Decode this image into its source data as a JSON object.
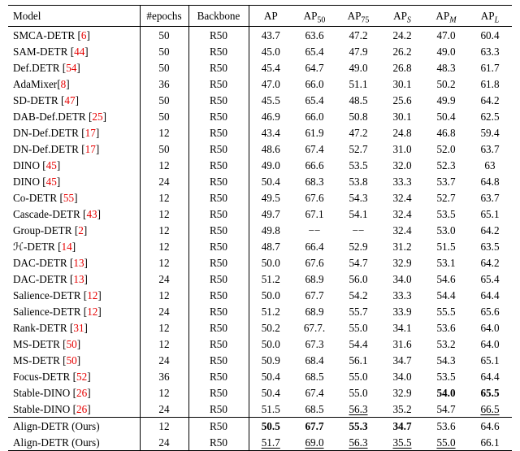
{
  "chart_data": {
    "type": "table",
    "title": "",
    "columns": [
      "Model",
      "#epochs",
      "Backbone",
      "AP",
      "AP50",
      "AP75",
      "AP_S",
      "AP_M",
      "AP_L"
    ],
    "rows": [
      [
        "SMCA-DETR [6]",
        50,
        "R50",
        43.7,
        63.6,
        47.2,
        24.2,
        47.0,
        60.4
      ],
      [
        "SAM-DETR [44]",
        50,
        "R50",
        45.0,
        65.4,
        47.9,
        26.2,
        49.0,
        63.3
      ],
      [
        "Def.DETR [54]",
        50,
        "R50",
        45.4,
        64.7,
        49.0,
        26.8,
        48.3,
        61.7
      ],
      [
        "AdaMixer[8]",
        36,
        "R50",
        47.0,
        66.0,
        51.1,
        30.1,
        50.2,
        61.8
      ],
      [
        "SD-DETR [47]",
        50,
        "R50",
        45.5,
        65.4,
        48.5,
        25.6,
        49.9,
        64.2
      ],
      [
        "DAB-Def.DETR [25]",
        50,
        "R50",
        46.9,
        66.0,
        50.8,
        30.1,
        50.4,
        62.5
      ],
      [
        "DN-Def.DETR [17]",
        12,
        "R50",
        43.4,
        61.9,
        47.2,
        24.8,
        46.8,
        59.4
      ],
      [
        "DN-Def.DETR [17]",
        50,
        "R50",
        48.6,
        67.4,
        52.7,
        31.0,
        52.0,
        63.7
      ],
      [
        "DINO [45]",
        12,
        "R50",
        49.0,
        66.6,
        53.5,
        32.0,
        52.3,
        63
      ],
      [
        "DINO [45]",
        24,
        "R50",
        50.4,
        68.3,
        53.8,
        33.3,
        53.7,
        64.8
      ],
      [
        "Co-DETR [55]",
        12,
        "R50",
        49.5,
        67.6,
        54.3,
        32.4,
        52.7,
        63.7
      ],
      [
        "Cascade-DETR [43]",
        12,
        "R50",
        49.7,
        67.1,
        54.1,
        32.4,
        53.5,
        65.1
      ],
      [
        "Group-DETR [2]",
        12,
        "R50",
        49.8,
        "−−",
        "−−",
        32.4,
        53.0,
        64.2
      ],
      [
        "H-DETR [14]",
        12,
        "R50",
        48.7,
        66.4,
        52.9,
        31.2,
        51.5,
        63.5
      ],
      [
        "DAC-DETR [13]",
        12,
        "R50",
        50.0,
        67.6,
        54.7,
        32.9,
        53.1,
        64.2
      ],
      [
        "DAC-DETR [13]",
        24,
        "R50",
        51.2,
        68.9,
        56.0,
        34.0,
        54.6,
        65.4
      ],
      [
        "Salience-DETR [12]",
        12,
        "R50",
        50.0,
        67.7,
        54.2,
        33.3,
        54.4,
        64.4
      ],
      [
        "Salience-DETR [12]",
        24,
        "R50",
        51.2,
        68.9,
        55.7,
        33.9,
        55.5,
        65.6
      ],
      [
        "Rank-DETR [31]",
        12,
        "R50",
        50.2,
        "67.7.",
        55.0,
        34.1,
        53.6,
        64.0
      ],
      [
        "MS-DETR [50]",
        12,
        "R50",
        50.0,
        67.3,
        54.4,
        31.6,
        53.2,
        64.0
      ],
      [
        "MS-DETR [50]",
        24,
        "R50",
        50.9,
        68.4,
        56.1,
        34.7,
        54.3,
        65.1
      ],
      [
        "Focus-DETR [52]",
        36,
        "R50",
        50.4,
        68.5,
        55.0,
        34.0,
        53.5,
        64.4
      ],
      [
        "Stable-DINO [26]",
        12,
        "R50",
        50.4,
        67.4,
        55.0,
        32.9,
        54.0,
        65.5
      ],
      [
        "Stable-DINO [26]",
        24,
        "R50",
        51.5,
        68.5,
        56.3,
        35.2,
        54.7,
        66.5
      ],
      [
        "Align-DETR (Ours)",
        12,
        "R50",
        50.5,
        67.7,
        55.3,
        34.7,
        53.6,
        64.6
      ],
      [
        "Align-DETR (Ours)",
        24,
        "R50",
        51.7,
        69.0,
        56.3,
        35.5,
        55.0,
        66.1
      ]
    ],
    "styles": {
      "22": {
        "AP_M": "bold",
        "AP_L": "bold"
      },
      "23": {
        "AP75": "uline",
        "AP_L": "uline"
      },
      "24": {
        "AP": "bold",
        "AP50": "bold",
        "AP75": "bold",
        "AP_S": "bold"
      },
      "25": {
        "AP": "uline",
        "AP50": "uline",
        "AP75": "uline",
        "AP_S": "uline",
        "AP_M": "uline"
      }
    },
    "separator_before_row": 24
  },
  "header": {
    "model": "Model",
    "epochs": "#epochs",
    "backbone": "Backbone",
    "ap": "AP",
    "ap50_pre": "AP",
    "ap50_sub": "50",
    "ap75_pre": "AP",
    "ap75_sub": "75",
    "aps_pre": "AP",
    "aps_sub": "S",
    "apm_pre": "AP",
    "apm_sub": "M",
    "apl_pre": "AP",
    "apl_sub": "L"
  },
  "rows": [
    {
      "model_pre": "SMCA-DETR [",
      "cite": "6",
      "model_post": "]",
      "html_model": false,
      "epochs": "50",
      "backbone": "R50",
      "m": [
        "43.7",
        "63.6",
        "47.2",
        "24.2",
        "47.0",
        "60.4"
      ],
      "s": [
        "",
        "",
        "",
        "",
        "",
        ""
      ]
    },
    {
      "model_pre": "SAM-DETR [",
      "cite": "44",
      "model_post": "]",
      "html_model": false,
      "epochs": "50",
      "backbone": "R50",
      "m": [
        "45.0",
        "65.4",
        "47.9",
        "26.2",
        "49.0",
        "63.3"
      ],
      "s": [
        "",
        "",
        "",
        "",
        "",
        ""
      ]
    },
    {
      "model_pre": "Def.DETR [",
      "cite": "54",
      "model_post": "]",
      "html_model": false,
      "epochs": "50",
      "backbone": "R50",
      "m": [
        "45.4",
        "64.7",
        "49.0",
        "26.8",
        "48.3",
        "61.7"
      ],
      "s": [
        "",
        "",
        "",
        "",
        "",
        ""
      ]
    },
    {
      "model_pre": "AdaMixer[",
      "cite": "8",
      "model_post": "]",
      "html_model": false,
      "epochs": "36",
      "backbone": "R50",
      "m": [
        "47.0",
        "66.0",
        "51.1",
        "30.1",
        "50.2",
        "61.8"
      ],
      "s": [
        "",
        "",
        "",
        "",
        "",
        ""
      ]
    },
    {
      "model_pre": "SD-DETR [",
      "cite": "47",
      "model_post": "]",
      "html_model": false,
      "epochs": "50",
      "backbone": "R50",
      "m": [
        "45.5",
        "65.4",
        "48.5",
        "25.6",
        "49.9",
        "64.2"
      ],
      "s": [
        "",
        "",
        "",
        "",
        "",
        ""
      ]
    },
    {
      "model_pre": "DAB-Def.DETR [",
      "cite": "25",
      "model_post": "]",
      "html_model": false,
      "epochs": "50",
      "backbone": "R50",
      "m": [
        "46.9",
        "66.0",
        "50.8",
        "30.1",
        "50.4",
        "62.5"
      ],
      "s": [
        "",
        "",
        "",
        "",
        "",
        ""
      ]
    },
    {
      "model_pre": "DN-Def.DETR [",
      "cite": "17",
      "model_post": "]",
      "html_model": false,
      "epochs": "12",
      "backbone": "R50",
      "m": [
        "43.4",
        "61.9",
        "47.2",
        "24.8",
        "46.8",
        "59.4"
      ],
      "s": [
        "",
        "",
        "",
        "",
        "",
        ""
      ]
    },
    {
      "model_pre": "DN-Def.DETR [",
      "cite": "17",
      "model_post": "]",
      "html_model": false,
      "epochs": "50",
      "backbone": "R50",
      "m": [
        "48.6",
        "67.4",
        "52.7",
        "31.0",
        "52.0",
        "63.7"
      ],
      "s": [
        "",
        "",
        "",
        "",
        "",
        ""
      ]
    },
    {
      "model_pre": "DINO [",
      "cite": "45",
      "model_post": "]",
      "html_model": false,
      "epochs": "12",
      "backbone": "R50",
      "m": [
        "49.0",
        "66.6",
        "53.5",
        "32.0",
        "52.3",
        "63"
      ],
      "s": [
        "",
        "",
        "",
        "",
        "",
        ""
      ]
    },
    {
      "model_pre": "DINO [",
      "cite": "45",
      "model_post": "]",
      "html_model": false,
      "epochs": "24",
      "backbone": "R50",
      "m": [
        "50.4",
        "68.3",
        "53.8",
        "33.3",
        "53.7",
        "64.8"
      ],
      "s": [
        "",
        "",
        "",
        "",
        "",
        ""
      ]
    },
    {
      "model_pre": "Co-DETR [",
      "cite": "55",
      "model_post": "]",
      "html_model": false,
      "epochs": "12",
      "backbone": "R50",
      "m": [
        "49.5",
        "67.6",
        "54.3",
        "32.4",
        "52.7",
        "63.7"
      ],
      "s": [
        "",
        "",
        "",
        "",
        "",
        ""
      ]
    },
    {
      "model_pre": "Cascade-DETR [",
      "cite": "43",
      "model_post": "]",
      "html_model": false,
      "epochs": "12",
      "backbone": "R50",
      "m": [
        "49.7",
        "67.1",
        "54.1",
        "32.4",
        "53.5",
        "65.1"
      ],
      "s": [
        "",
        "",
        "",
        "",
        "",
        ""
      ]
    },
    {
      "model_pre": "Group-DETR [",
      "cite": "2",
      "model_post": "]",
      "html_model": false,
      "epochs": "12",
      "backbone": "R50",
      "m": [
        "49.8",
        "−−",
        "−−",
        "32.4",
        "53.0",
        "64.2"
      ],
      "s": [
        "",
        "",
        "",
        "",
        "",
        ""
      ]
    },
    {
      "model_pre": "ℋ-DETR [",
      "cite": "14",
      "model_post": "]",
      "html_model": false,
      "epochs": "12",
      "backbone": "R50",
      "m": [
        "48.7",
        "66.4",
        "52.9",
        "31.2",
        "51.5",
        "63.5"
      ],
      "s": [
        "",
        "",
        "",
        "",
        "",
        ""
      ]
    },
    {
      "model_pre": "DAC-DETR [",
      "cite": "13",
      "model_post": "]",
      "html_model": false,
      "epochs": "12",
      "backbone": "R50",
      "m": [
        "50.0",
        "67.6",
        "54.7",
        "32.9",
        "53.1",
        "64.2"
      ],
      "s": [
        "",
        "",
        "",
        "",
        "",
        ""
      ]
    },
    {
      "model_pre": "DAC-DETR [",
      "cite": "13",
      "model_post": "]",
      "html_model": false,
      "epochs": "24",
      "backbone": "R50",
      "m": [
        "51.2",
        "68.9",
        "56.0",
        "34.0",
        "54.6",
        "65.4"
      ],
      "s": [
        "",
        "",
        "",
        "",
        "",
        ""
      ]
    },
    {
      "model_pre": "Salience-DETR [",
      "cite": "12",
      "model_post": "]",
      "html_model": false,
      "epochs": "12",
      "backbone": "R50",
      "m": [
        "50.0",
        "67.7",
        "54.2",
        "33.3",
        "54.4",
        "64.4"
      ],
      "s": [
        "",
        "",
        "",
        "",
        "",
        ""
      ]
    },
    {
      "model_pre": "Salience-DETR [",
      "cite": "12",
      "model_post": "]",
      "html_model": false,
      "epochs": "24",
      "backbone": "R50",
      "m": [
        "51.2",
        "68.9",
        "55.7",
        "33.9",
        "55.5",
        "65.6"
      ],
      "s": [
        "",
        "",
        "",
        "",
        "",
        ""
      ]
    },
    {
      "model_pre": "Rank-DETR [",
      "cite": "31",
      "model_post": "]",
      "html_model": false,
      "epochs": "12",
      "backbone": "R50",
      "m": [
        "50.2",
        "67.7.",
        "55.0",
        "34.1",
        "53.6",
        "64.0"
      ],
      "s": [
        "",
        "",
        "",
        "",
        "",
        ""
      ]
    },
    {
      "model_pre": "MS-DETR [",
      "cite": "50",
      "model_post": "]",
      "html_model": false,
      "epochs": "12",
      "backbone": "R50",
      "m": [
        "50.0",
        "67.3",
        "54.4",
        "31.6",
        "53.2",
        "64.0"
      ],
      "s": [
        "",
        "",
        "",
        "",
        "",
        ""
      ]
    },
    {
      "model_pre": "MS-DETR [",
      "cite": "50",
      "model_post": "]",
      "html_model": false,
      "epochs": "24",
      "backbone": "R50",
      "m": [
        "50.9",
        "68.4",
        "56.1",
        "34.7",
        "54.3",
        "65.1"
      ],
      "s": [
        "",
        "",
        "",
        "",
        "",
        ""
      ]
    },
    {
      "model_pre": "Focus-DETR [",
      "cite": "52",
      "model_post": "]",
      "html_model": false,
      "epochs": "36",
      "backbone": "R50",
      "m": [
        "50.4",
        "68.5",
        "55.0",
        "34.0",
        "53.5",
        "64.4"
      ],
      "s": [
        "",
        "",
        "",
        "",
        "",
        ""
      ]
    },
    {
      "model_pre": "Stable-DINO [",
      "cite": "26",
      "model_post": "]",
      "html_model": false,
      "epochs": "12",
      "backbone": "R50",
      "m": [
        "50.4",
        "67.4",
        "55.0",
        "32.9",
        "54.0",
        "65.5"
      ],
      "s": [
        "",
        "",
        "",
        "",
        "bold",
        "bold"
      ]
    },
    {
      "model_pre": "Stable-DINO [",
      "cite": "26",
      "model_post": "]",
      "html_model": false,
      "epochs": "24",
      "backbone": "R50",
      "m": [
        "51.5",
        "68.5",
        "56.3",
        "35.2",
        "54.7",
        "66.5"
      ],
      "s": [
        "",
        "",
        "uline",
        "",
        "",
        "uline"
      ]
    },
    {
      "model_pre": "Align-DETR (Ours)",
      "cite": "",
      "model_post": "",
      "html_model": false,
      "epochs": "12",
      "backbone": "R50",
      "m": [
        "50.5",
        "67.7",
        "55.3",
        "34.7",
        "53.6",
        "64.6"
      ],
      "s": [
        "bold",
        "bold",
        "bold",
        "bold",
        "",
        ""
      ],
      "sep": true
    },
    {
      "model_pre": "Align-DETR (Ours)",
      "cite": "",
      "model_post": "",
      "html_model": false,
      "epochs": "24",
      "backbone": "R50",
      "m": [
        "51.7",
        "69.0",
        "56.3",
        "35.5",
        "55.0",
        "66.1"
      ],
      "s": [
        "uline",
        "uline",
        "uline",
        "uline",
        "uline",
        ""
      ]
    }
  ]
}
